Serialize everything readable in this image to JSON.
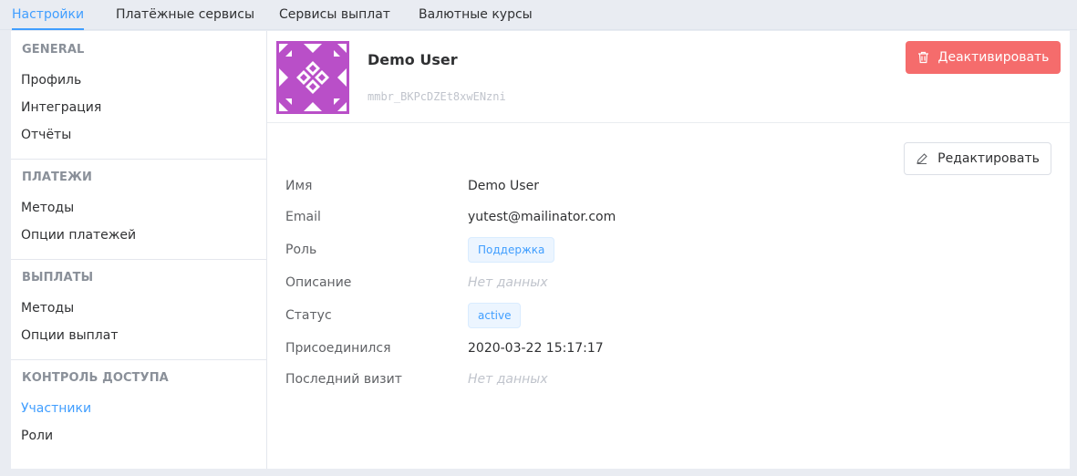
{
  "tabs": [
    {
      "label": "Настройки",
      "active": true
    },
    {
      "label": "Платёжные сервисы",
      "active": false
    },
    {
      "label": "Сервисы выплат",
      "active": false
    },
    {
      "label": "Валютные курсы",
      "active": false
    }
  ],
  "sidebar": {
    "general": {
      "title": "GENERAL",
      "items": [
        "Профиль",
        "Интеграция",
        "Отчёты"
      ]
    },
    "payments": {
      "title": "ПЛАТЕЖИ",
      "items": [
        "Методы",
        "Опции платежей"
      ]
    },
    "payouts": {
      "title": "ВЫПЛАТЫ",
      "items": [
        "Методы",
        "Опции выплат"
      ]
    },
    "access": {
      "title": "КОНТРОЛЬ ДОСТУПА",
      "items": [
        "Участники",
        "Роли"
      ],
      "active_item": "Участники"
    }
  },
  "user": {
    "name": "Demo User",
    "id": "mmbr_BKPcDZEt8xwENzni",
    "avatar_color": "#b94fc8"
  },
  "actions": {
    "deactivate_label": "Деактивировать",
    "edit_label": "Редактировать"
  },
  "details": {
    "name_label": "Имя",
    "name_value": "Demo User",
    "email_label": "Email",
    "email_value": "yutest@mailinator.com",
    "role_label": "Роль",
    "role_value": "Поддержка",
    "description_label": "Описание",
    "description_value": "Нет данных",
    "status_label": "Статус",
    "status_value": "active",
    "joined_label": "Присоединился",
    "joined_value": "2020-03-22 15:17:17",
    "last_visit_label": "Последний визит",
    "last_visit_value": "Нет данных"
  },
  "colors": {
    "accent": "#409eff",
    "danger": "#f56c6c"
  }
}
